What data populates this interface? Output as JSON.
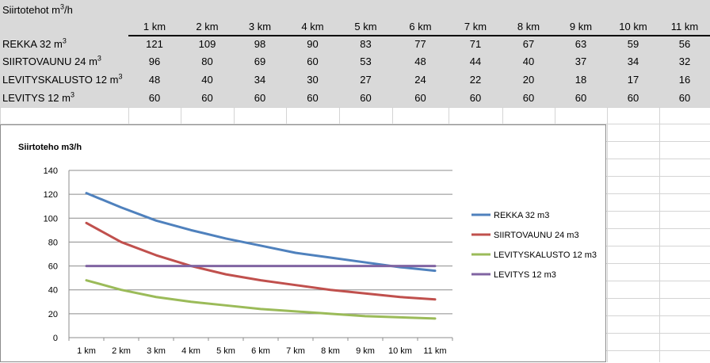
{
  "sheet": {
    "title": "Siirtotehot m",
    "title_sup": "3",
    "title_suffix": "/h",
    "columns": [
      "1 km",
      "2 km",
      "3 km",
      "4 km",
      "5 km",
      "6 km",
      "7 km",
      "8 km",
      "9 km",
      "10 km",
      "11 km"
    ],
    "rows": [
      {
        "label": "REKKA 32 m",
        "sup": "3",
        "values": [
          "121",
          "109",
          "98",
          "90",
          "83",
          "77",
          "71",
          "67",
          "63",
          "59",
          "56"
        ]
      },
      {
        "label": "SIIRTOVAUNU 24 m",
        "sup": "3",
        "values": [
          "96",
          "80",
          "69",
          "60",
          "53",
          "48",
          "44",
          "40",
          "37",
          "34",
          "32"
        ]
      },
      {
        "label": "LEVITYSKALUSTO 12 m",
        "sup": "3",
        "values": [
          "48",
          "40",
          "34",
          "30",
          "27",
          "24",
          "22",
          "20",
          "18",
          "17",
          "16"
        ]
      },
      {
        "label": "LEVITYS 12 m",
        "sup": "3",
        "values": [
          "60",
          "60",
          "60",
          "60",
          "60",
          "60",
          "60",
          "60",
          "60",
          "60",
          "60"
        ]
      }
    ]
  },
  "chart_data": {
    "type": "line",
    "title": "Siirtoteho m3/h",
    "categories": [
      "1 km",
      "2 km",
      "3 km",
      "4 km",
      "5 km",
      "6 km",
      "7 km",
      "8 km",
      "9 km",
      "10 km",
      "11 km"
    ],
    "ylim": [
      0,
      140
    ],
    "yticks": [
      "0",
      "20",
      "40",
      "60",
      "80",
      "100",
      "120",
      "140"
    ],
    "grid": true,
    "legend_position": "right",
    "series": [
      {
        "name": "REKKA 32 m3",
        "color": "#4f81bd",
        "values": [
          121,
          109,
          98,
          90,
          83,
          77,
          71,
          67,
          63,
          59,
          56
        ]
      },
      {
        "name": "SIIRTOVAUNU 24 m3",
        "color": "#c0504d",
        "values": [
          96,
          80,
          69,
          60,
          53,
          48,
          44,
          40,
          37,
          34,
          32
        ]
      },
      {
        "name": "LEVITYSKALUSTO 12 m3",
        "color": "#9bbb59",
        "values": [
          48,
          40,
          34,
          30,
          27,
          24,
          22,
          20,
          18,
          17,
          16
        ]
      },
      {
        "name": "LEVITYS 12 m3",
        "color": "#8064a2",
        "values": [
          60,
          60,
          60,
          60,
          60,
          60,
          60,
          60,
          60,
          60,
          60
        ]
      }
    ]
  }
}
